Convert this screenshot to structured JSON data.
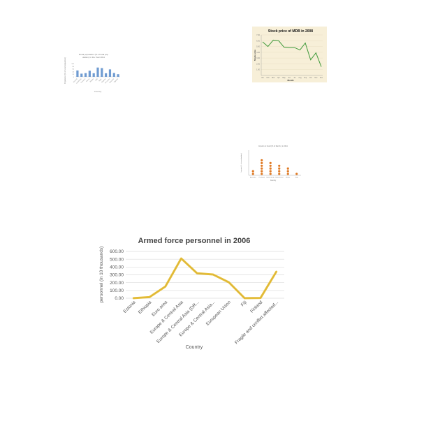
{
  "chart_data": [
    {
      "type": "bar",
      "title": "Rural population (% of total population) in the Year 2011",
      "xlabel": "Country",
      "ylabel": "Population (% of total population)",
      "ylim": [
        0,
        100
      ],
      "yticks": [
        "100",
        "80",
        "60",
        "40",
        "20",
        "0"
      ],
      "categories": [
        "Burundi",
        "Cambodia",
        "Comoros",
        "Kenya",
        "Malawi",
        "Mali",
        "Niger",
        "Rwanda",
        "Sri Lanka",
        "Tanzania",
        "Uganda"
      ],
      "values": [
        48,
        24,
        28,
        46,
        27,
        70,
        66,
        27,
        56,
        29,
        20
      ],
      "color": "#6f9bd1"
    },
    {
      "type": "line",
      "title": "Stock price of MDB in 2008",
      "xlabel": "Month",
      "ylabel": "Stock price",
      "ylim": [
        0,
        7
      ],
      "yticks": [
        "7.00",
        "6.00",
        "5.00",
        "4.00",
        "3.00",
        "2.00",
        "1.00"
      ],
      "categories": [
        "Jan",
        "Feb",
        "Mar",
        "Apr",
        "May",
        "Jun",
        "Jul",
        "Aug",
        "Sep",
        "Oct",
        "Nov",
        "Dec"
      ],
      "values": [
        5.8,
        5.0,
        6.1,
        6.0,
        4.9,
        4.8,
        4.8,
        4.4,
        5.6,
        2.7,
        3.9,
        1.5
      ],
      "color": "#3f9a3a",
      "background": "#f7efd8"
    },
    {
      "type": "scatter",
      "title": "Imports in Food (% of Merch.) in 2011",
      "xlabel": "Country",
      "ylabel": "Imports (% of merchandise)",
      "ylim": [
        0,
        10
      ],
      "categories": [
        "Australia",
        "Portugal",
        "Netherlands",
        "Switzerland",
        "Belize",
        "Italy"
      ],
      "values": [
        2,
        6,
        5,
        4,
        3,
        1
      ],
      "color": "#e07b26"
    },
    {
      "type": "line",
      "title": "Armed force personnel in 2006",
      "xlabel": "Country",
      "ylabel": "personnel (in 10 thousands)",
      "ylim": [
        0,
        600
      ],
      "yticks": [
        "600.00",
        "500.00",
        "400.00",
        "300.00",
        "200.00",
        "100.00",
        "0.00"
      ],
      "categories": [
        "Estonia",
        "Ethiopia",
        "Euro area",
        "Europe & Central Asia",
        "Europe & Central Asia (DR...",
        "Europe & Central Asia...",
        "European Union",
        "Fiji",
        "Finland",
        "Fragile and conflict affected..."
      ],
      "values": [
        1,
        15,
        150,
        510,
        320,
        305,
        205,
        1,
        3,
        340
      ],
      "color": "#e8c13a"
    }
  ]
}
